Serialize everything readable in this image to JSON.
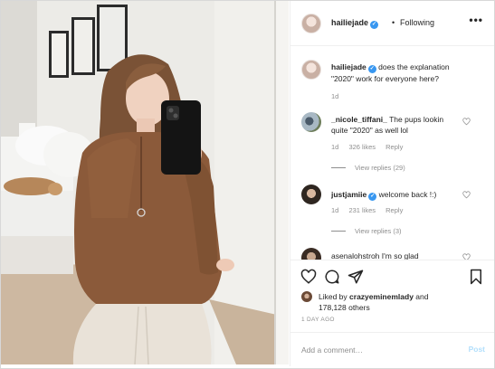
{
  "post": {
    "author": "hailiejade",
    "follow_status": "Following",
    "dot": "•",
    "more_icon": "more-options-icon"
  },
  "comments": [
    {
      "user": "hailiejade",
      "text": "does the explanation \"2020\" work for everyone here?",
      "time": "1d",
      "likes": "",
      "reply": ""
    },
    {
      "user": "_nicole_tiffani_",
      "text": "The pups lookin quite \"2020\" as well lol",
      "time": "1d",
      "likes": "326 likes",
      "reply": "Reply",
      "view_replies": "View replies (29)"
    },
    {
      "user": "justjamiie",
      "text": "welcome back !:)",
      "time": "1d",
      "likes": "231 likes",
      "reply": "Reply",
      "view_replies": "View replies (3)"
    },
    {
      "user": "asenalohstroh",
      "text": "I'm so glad"
    }
  ],
  "likes_line": {
    "prefix": "Liked by",
    "user": "crazyeminemlady",
    "and": "and",
    "count": "178,128 others"
  },
  "time_ago": "1 DAY AGO",
  "add_comment": {
    "placeholder": "Add a comment…",
    "post_label": "Post"
  },
  "colors": {
    "verified": "#3897f0",
    "post_disabled": "#b2dffc",
    "meta": "#8e8e8e"
  }
}
